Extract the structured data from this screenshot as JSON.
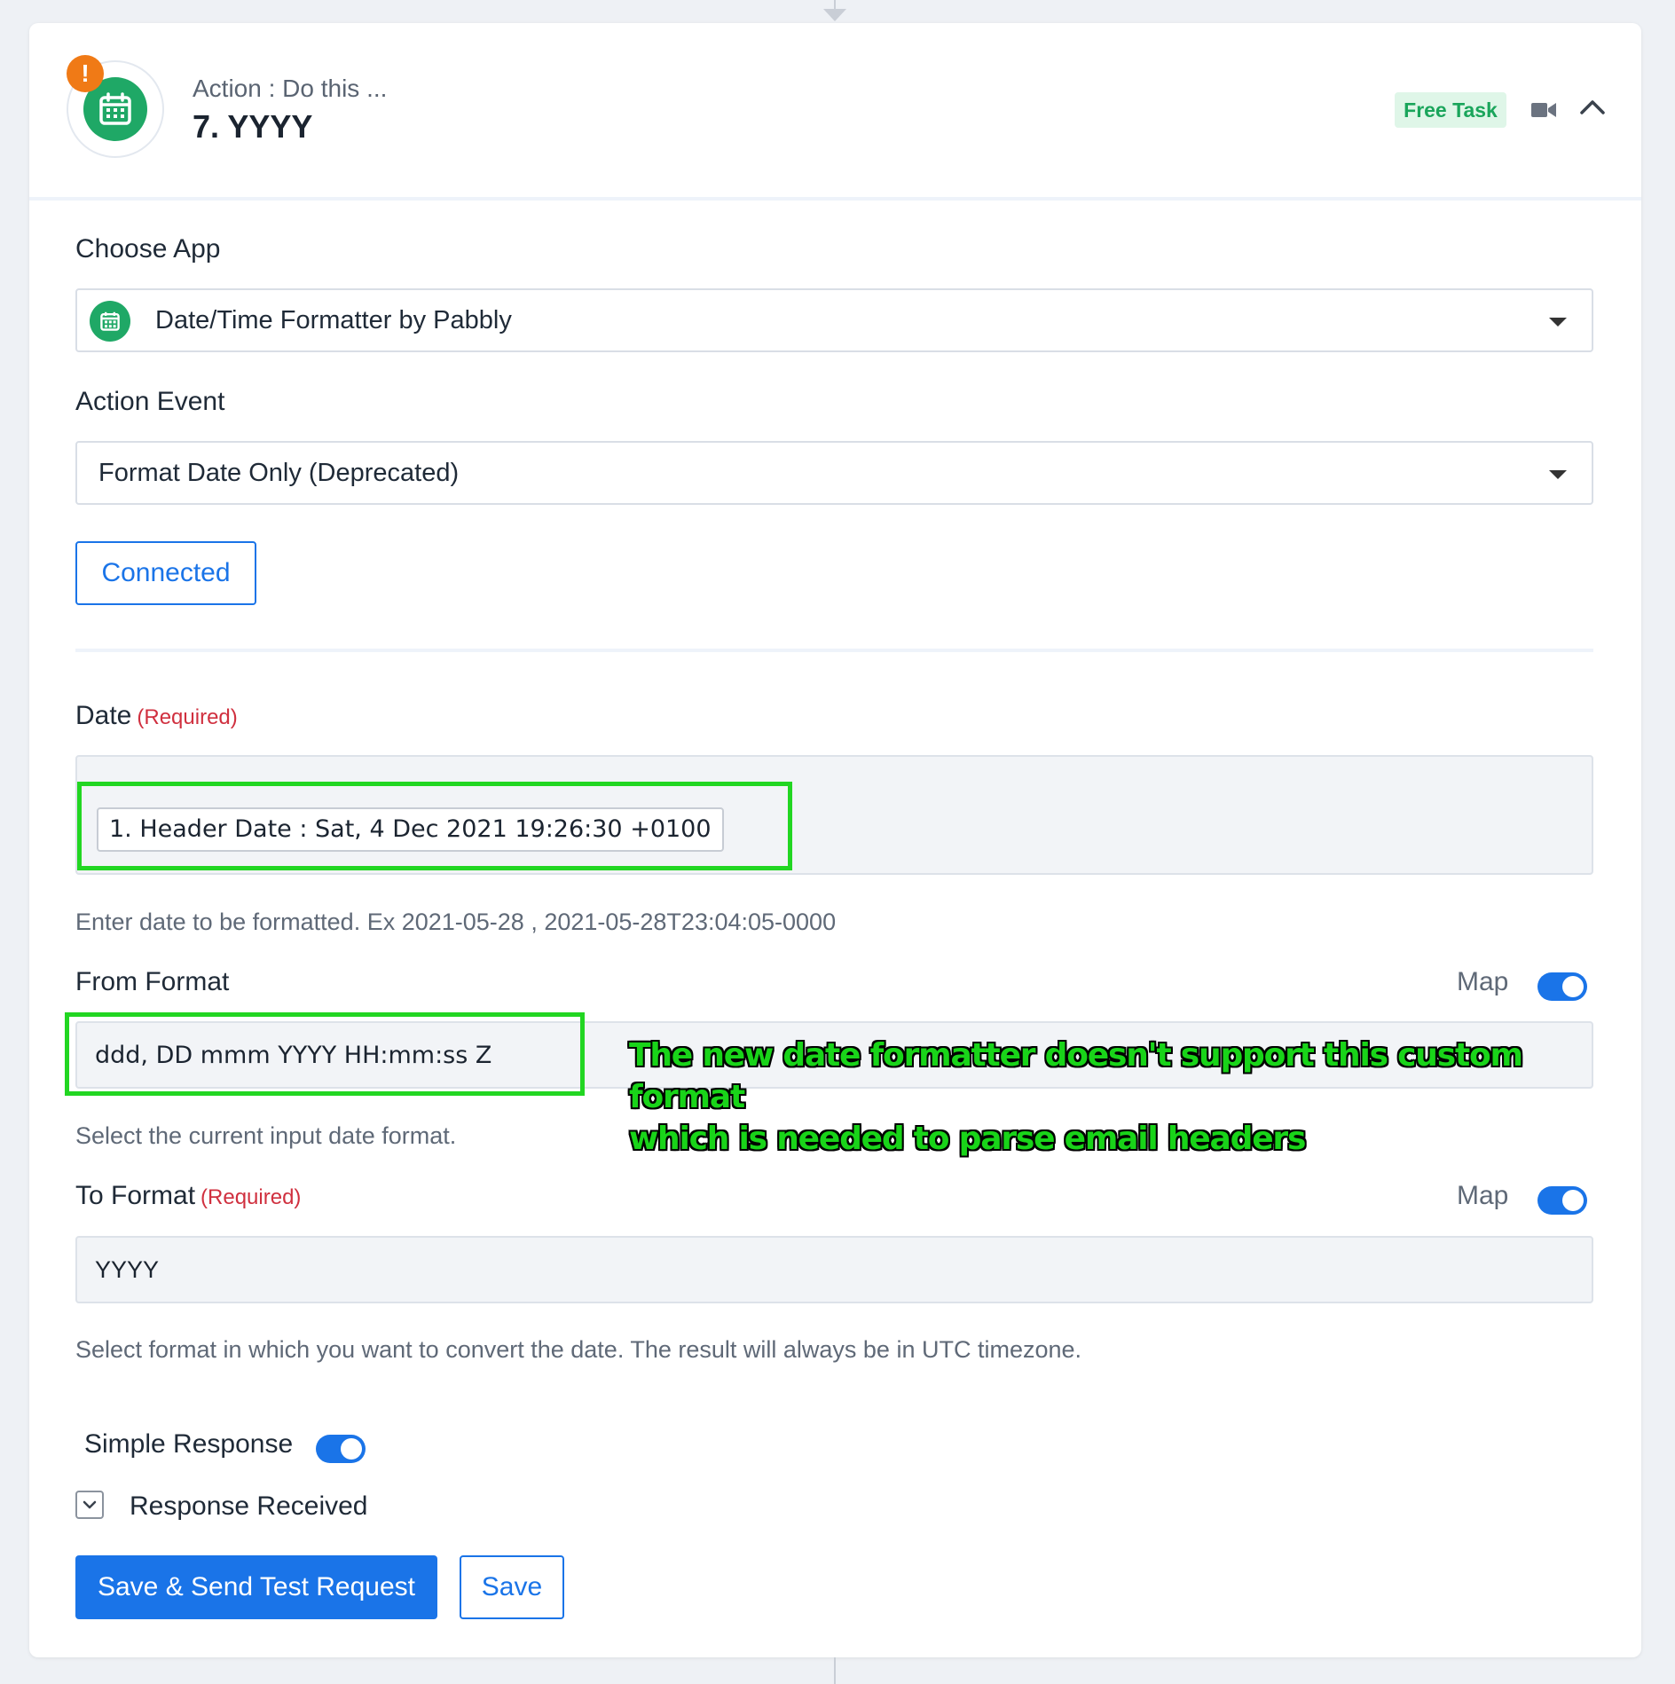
{
  "header": {
    "subtitle": "Action : Do this ...",
    "title": "7. YYYY",
    "badge": "Free Task",
    "warning_symbol": "!",
    "icons": [
      "calendar-icon",
      "warning-icon",
      "video-icon",
      "chevron-up-icon"
    ]
  },
  "choose_app": {
    "label": "Choose App",
    "value": "Date/Time Formatter by Pabbly"
  },
  "action_event": {
    "label": "Action Event",
    "value": "Format Date Only (Deprecated)"
  },
  "connection": {
    "label": "Connected"
  },
  "date_field": {
    "label": "Date",
    "required": "(Required)",
    "chip": "1. Header Date : Sat, 4 Dec 2021 19:26:30 +0100",
    "help": "Enter date to be formatted. Ex 2021-05-28 , 2021-05-28T23:04:05-0000"
  },
  "from_format": {
    "label": "From Format",
    "map_label": "Map",
    "value": "ddd, DD mmm YYYY HH:mm:ss Z",
    "help": "Select the current input date format."
  },
  "annotation": {
    "line1": "The new date formatter doesn't support this custom format",
    "line2": "which is needed to parse email headers"
  },
  "to_format": {
    "label": "To Format",
    "required": "(Required)",
    "map_label": "Map",
    "value": "YYYY",
    "help": "Select format in which you want to convert the date. The result will always be in UTC timezone."
  },
  "simple_response": {
    "label": "Simple Response"
  },
  "response_received": {
    "label": "Response Received"
  },
  "buttons": {
    "save_and_test": "Save & Send Test Request",
    "save": "Save"
  },
  "colors": {
    "accent": "#1a74e8",
    "app_green": "#1fa866",
    "warning": "#f07a16",
    "required": "#d0303f",
    "highlight": "#22d622"
  }
}
